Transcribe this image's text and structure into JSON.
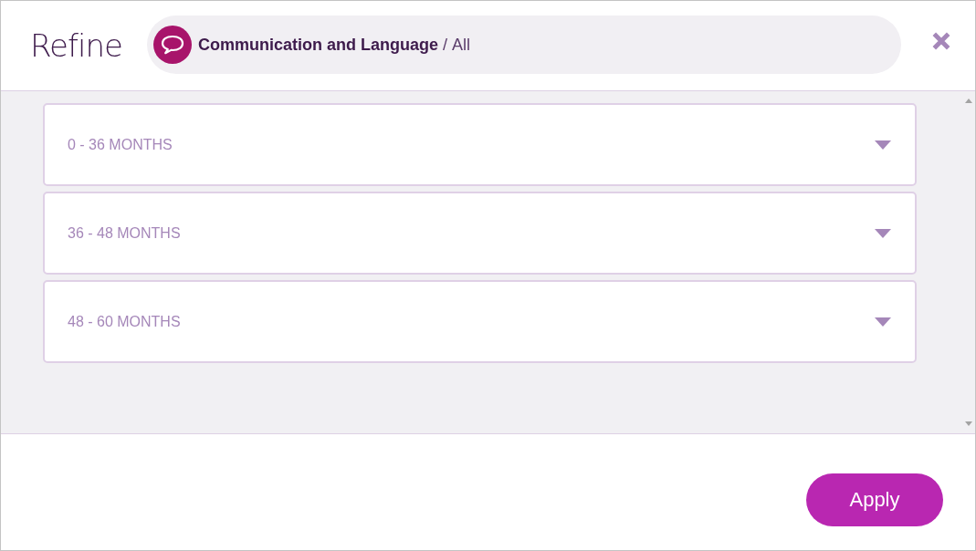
{
  "header": {
    "title": "Refine",
    "breadcrumb": {
      "category": "Communication and Language",
      "separator": "/",
      "subcategory": "All"
    }
  },
  "sections": [
    {
      "label": "0 - 36 MONTHS",
      "expanded": false
    },
    {
      "label": "36 - 48 MONTHS",
      "expanded": false
    },
    {
      "label": "48 - 60 MONTHS",
      "expanded": false
    }
  ],
  "footer": {
    "button": "Apply"
  }
}
